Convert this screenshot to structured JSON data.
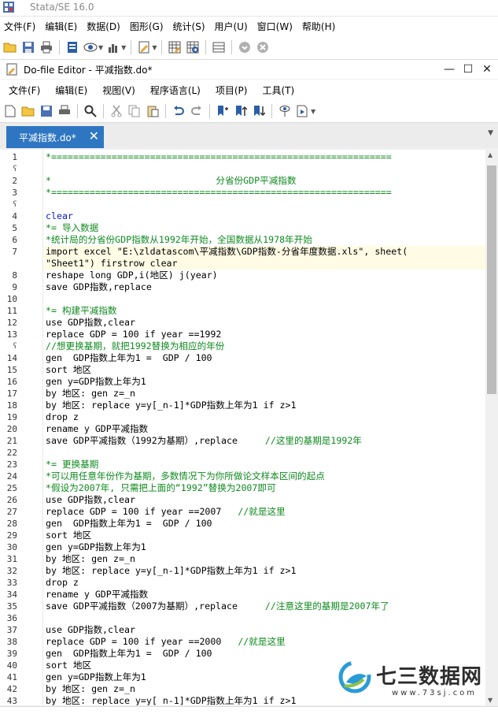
{
  "app": {
    "title": "Stata/SE 16.0",
    "menu": [
      "文件(F)",
      "编辑(E)",
      "数据(D)",
      "图形(G)",
      "统计(S)",
      "用户(U)",
      "窗口(W)",
      "帮助(H)"
    ]
  },
  "editor_window": {
    "title": "Do-file Editor - 平减指数.do*",
    "menu": [
      "文件(F)",
      "编辑(E)",
      "视图(V)",
      "程序语言(L)",
      "项目(P)",
      "工具(T)"
    ],
    "minimize": "—",
    "maximize": "☐",
    "close": "✕"
  },
  "tab": {
    "label": "平减指数.do*",
    "close": "✕"
  },
  "colors": {
    "comment": "#0f8a1f",
    "keyword": "#1020c8",
    "tab_active": "#2e76c1",
    "current_line": "#fffbe4"
  },
  "gutter": [
    {
      "n": "1",
      "fold": ""
    },
    {
      "n": "",
      "fold": "ʕ"
    },
    {
      "n": "2",
      "fold": ""
    },
    {
      "n": "3",
      "fold": ""
    },
    {
      "n": "",
      "fold": "ʕ"
    },
    {
      "n": "4",
      "fold": ""
    },
    {
      "n": "5",
      "fold": ""
    },
    {
      "n": "6",
      "fold": ""
    },
    {
      "n": "7",
      "fold": ""
    },
    {
      "n": "",
      "fold": ""
    },
    {
      "n": "8",
      "fold": ""
    },
    {
      "n": "9",
      "fold": ""
    },
    {
      "n": "10",
      "fold": ""
    },
    {
      "n": "11",
      "fold": ""
    },
    {
      "n": "12",
      "fold": ""
    },
    {
      "n": "13",
      "fold": ""
    },
    {
      "n": "",
      "fold": "ʕ"
    },
    {
      "n": "14",
      "fold": ""
    },
    {
      "n": "15",
      "fold": ""
    },
    {
      "n": "16",
      "fold": ""
    },
    {
      "n": "17",
      "fold": ""
    },
    {
      "n": "18",
      "fold": ""
    },
    {
      "n": "19",
      "fold": ""
    },
    {
      "n": "20",
      "fold": ""
    },
    {
      "n": "21",
      "fold": ""
    },
    {
      "n": "22",
      "fold": ""
    },
    {
      "n": "23",
      "fold": ""
    },
    {
      "n": "24",
      "fold": ""
    },
    {
      "n": "25",
      "fold": ""
    },
    {
      "n": "26",
      "fold": ""
    },
    {
      "n": "27",
      "fold": ""
    },
    {
      "n": "28",
      "fold": ""
    },
    {
      "n": "29",
      "fold": ""
    },
    {
      "n": "30",
      "fold": ""
    },
    {
      "n": "31",
      "fold": ""
    },
    {
      "n": "32",
      "fold": ""
    },
    {
      "n": "33",
      "fold": ""
    },
    {
      "n": "34",
      "fold": ""
    },
    {
      "n": "35",
      "fold": ""
    },
    {
      "n": "36",
      "fold": ""
    },
    {
      "n": "37",
      "fold": ""
    },
    {
      "n": "38",
      "fold": ""
    },
    {
      "n": "39",
      "fold": ""
    },
    {
      "n": "40",
      "fold": ""
    },
    {
      "n": "41",
      "fold": ""
    },
    {
      "n": "42",
      "fold": ""
    },
    {
      "n": "43",
      "fold": ""
    }
  ],
  "code_lines": [
    {
      "text": "*==============================================================",
      "style": "comment"
    },
    {
      "text": "",
      "style": "plain"
    },
    {
      "text": "*                              分省份GDP平减指数",
      "style": "comment"
    },
    {
      "text": "*==============================================================",
      "style": "comment"
    },
    {
      "text": "",
      "style": "plain"
    },
    {
      "text": "clear",
      "style": "keyword"
    },
    {
      "text": "*= 导入数据",
      "style": "comment"
    },
    {
      "text": "*统计局的分省份GDP指数从1992年开始，全国数据从1978年开始",
      "style": "comment"
    },
    {
      "text": "import excel \"E:\\zldatascom\\平减指数\\GDP指数-分省年度数据.xls\", sheet(",
      "style": "hl"
    },
    {
      "text": "\"Sheet1\") firstrow clear",
      "style": "hl"
    },
    {
      "text": "reshape long GDP,i(地区) j(year)",
      "style": "plain"
    },
    {
      "text": "save GDP指数,replace",
      "style": "plain"
    },
    {
      "text": "",
      "style": "plain"
    },
    {
      "text": "*= 构建平减指数",
      "style": "comment"
    },
    {
      "text": "use GDP指数,clear",
      "style": "plain"
    },
    {
      "text": "replace GDP = 100 if year ==1992",
      "style": "plain"
    },
    {
      "text": "//想更换基期，就把1992替换为相应的年份",
      "style": "comment"
    },
    {
      "text": "gen  GDP指数上年为1 =  GDP / 100",
      "style": "plain"
    },
    {
      "text": "sort 地区",
      "style": "plain"
    },
    {
      "text": "gen y=GDP指数上年为1",
      "style": "plain"
    },
    {
      "text": "by 地区: gen z=_n",
      "style": "plain"
    },
    {
      "text": "by 地区: replace y=y[_n-1]*GDP指数上年为1 if z>1",
      "style": "plain"
    },
    {
      "text": "drop z",
      "style": "plain"
    },
    {
      "text": "rename y GDP平减指数",
      "style": "plain"
    },
    {
      "text": "save GDP平减指数（1992为基期）,replace     //这里的基期是1992年",
      "style": "plain_comment",
      "split": 38
    },
    {
      "text": "",
      "style": "plain"
    },
    {
      "text": "*= 更换基期",
      "style": "comment"
    },
    {
      "text": "*可以用任意年份作为基期，多数情况下为你所做论文样本区间的起点",
      "style": "comment"
    },
    {
      "text": "*假设为2007年, 只需把上面的“1992”替换为2007即可",
      "style": "comment"
    },
    {
      "text": "use GDP指数,clear",
      "style": "plain"
    },
    {
      "text": "replace GDP = 100 if year ==2007   //就是这里",
      "style": "plain_comment",
      "split": 35
    },
    {
      "text": "gen  GDP指数上年为1 =  GDP / 100",
      "style": "plain"
    },
    {
      "text": "sort 地区",
      "style": "plain"
    },
    {
      "text": "gen y=GDP指数上年为1",
      "style": "plain"
    },
    {
      "text": "by 地区: gen z=_n",
      "style": "plain"
    },
    {
      "text": "by 地区: replace y=y[_n-1]*GDP指数上年为1 if z>1",
      "style": "plain"
    },
    {
      "text": "drop z",
      "style": "plain"
    },
    {
      "text": "rename y GDP平减指数",
      "style": "plain"
    },
    {
      "text": "save GDP平减指数（2007为基期）,replace     //注意这里的基期是2007年了",
      "style": "plain_comment",
      "split": 38
    },
    {
      "text": "",
      "style": "plain"
    },
    {
      "text": "use GDP指数,clear",
      "style": "plain"
    },
    {
      "text": "replace GDP = 100 if year ==2000   //就是这里",
      "style": "plain_comment",
      "split": 35
    },
    {
      "text": "gen  GDP指数上年为1 =  GDP / 100",
      "style": "plain"
    },
    {
      "text": "sort 地区",
      "style": "plain"
    },
    {
      "text": "gen y=GDP指数上年为1",
      "style": "plain"
    },
    {
      "text": "by 地区: gen z=_n",
      "style": "plain"
    },
    {
      "text": "by 地区: replace y=y[_n-1]*GDP指数上年为1 if z>1",
      "style": "plain"
    }
  ],
  "watermark": {
    "text": "七三数据网",
    "url": "www.73sj.com"
  }
}
